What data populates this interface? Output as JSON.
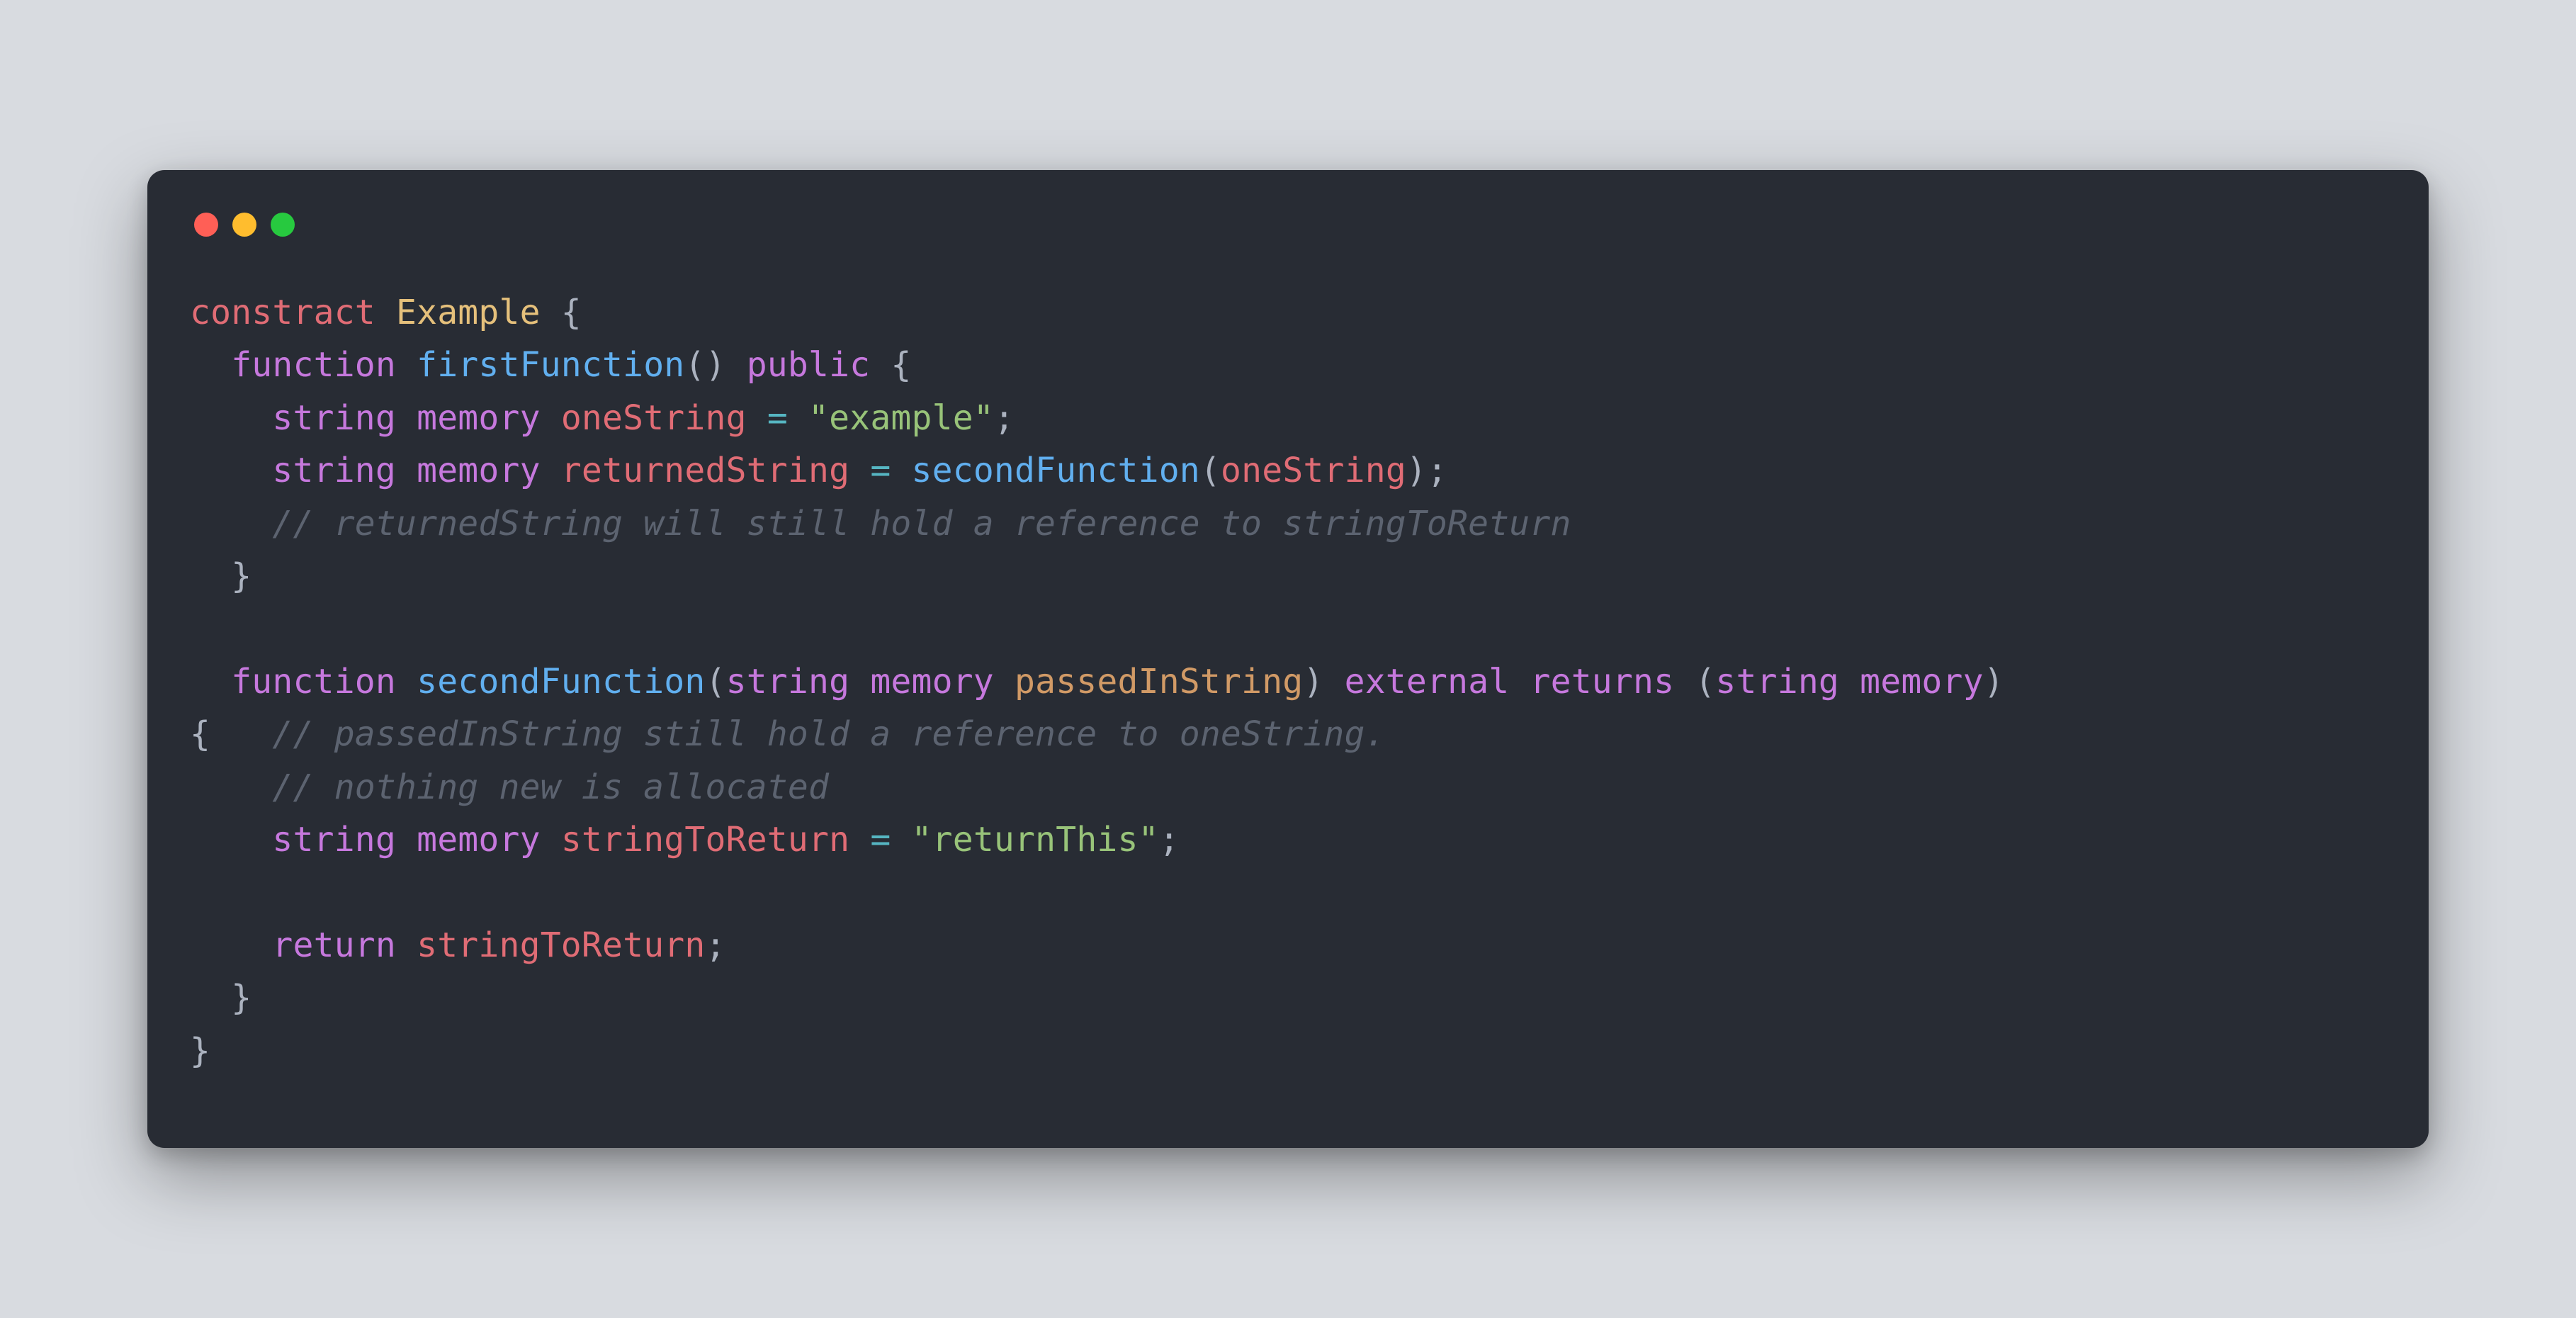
{
  "colors": {
    "background_page": "#d8dbe0",
    "background_window": "#282c34",
    "traffic_red": "#ff5f56",
    "traffic_yellow": "#ffbd2e",
    "traffic_green": "#27c93f",
    "keyword_red": "#e06c75",
    "keyword_purple": "#c678dd",
    "function_blue": "#61afef",
    "string_green": "#98c379",
    "operator_cyan": "#56b6c2",
    "identifier_yellow": "#e5c07b",
    "param_orange": "#d19a66",
    "comment_gray": "#5c6370",
    "plain": "#abb2bf"
  },
  "code": {
    "lines": [
      {
        "segments": [
          {
            "t": "constract",
            "c": "kw-red"
          },
          {
            "t": " ",
            "c": "plain"
          },
          {
            "t": "Example",
            "c": "ident"
          },
          {
            "t": " {",
            "c": "plain"
          }
        ]
      },
      {
        "segments": [
          {
            "t": "  ",
            "c": "plain"
          },
          {
            "t": "function",
            "c": "kw-purple"
          },
          {
            "t": " ",
            "c": "plain"
          },
          {
            "t": "firstFunction",
            "c": "fn"
          },
          {
            "t": "() ",
            "c": "plain"
          },
          {
            "t": "public",
            "c": "kw-purple"
          },
          {
            "t": " {",
            "c": "plain"
          }
        ]
      },
      {
        "segments": [
          {
            "t": "    ",
            "c": "plain"
          },
          {
            "t": "string",
            "c": "kw-purple"
          },
          {
            "t": " ",
            "c": "plain"
          },
          {
            "t": "memory",
            "c": "kw-purple"
          },
          {
            "t": " ",
            "c": "plain"
          },
          {
            "t": "oneString",
            "c": "kw-red"
          },
          {
            "t": " ",
            "c": "plain"
          },
          {
            "t": "=",
            "c": "op"
          },
          {
            "t": " ",
            "c": "plain"
          },
          {
            "t": "\"example\"",
            "c": "str"
          },
          {
            "t": ";",
            "c": "plain"
          }
        ]
      },
      {
        "segments": [
          {
            "t": "    ",
            "c": "plain"
          },
          {
            "t": "string",
            "c": "kw-purple"
          },
          {
            "t": " ",
            "c": "plain"
          },
          {
            "t": "memory",
            "c": "kw-purple"
          },
          {
            "t": " ",
            "c": "plain"
          },
          {
            "t": "returnedString",
            "c": "kw-red"
          },
          {
            "t": " ",
            "c": "plain"
          },
          {
            "t": "=",
            "c": "op"
          },
          {
            "t": " ",
            "c": "plain"
          },
          {
            "t": "secondFunction",
            "c": "fn"
          },
          {
            "t": "(",
            "c": "plain"
          },
          {
            "t": "oneString",
            "c": "kw-red"
          },
          {
            "t": ");",
            "c": "plain"
          }
        ]
      },
      {
        "segments": [
          {
            "t": "    ",
            "c": "plain"
          },
          {
            "t": "// returnedString will still hold a reference to stringToReturn",
            "c": "comment"
          }
        ]
      },
      {
        "segments": [
          {
            "t": "  }",
            "c": "plain"
          }
        ]
      },
      {
        "segments": [
          {
            "t": "",
            "c": "plain"
          }
        ]
      },
      {
        "segments": [
          {
            "t": "  ",
            "c": "plain"
          },
          {
            "t": "function",
            "c": "kw-purple"
          },
          {
            "t": " ",
            "c": "plain"
          },
          {
            "t": "secondFunction",
            "c": "fn"
          },
          {
            "t": "(",
            "c": "plain"
          },
          {
            "t": "string",
            "c": "kw-purple"
          },
          {
            "t": " ",
            "c": "plain"
          },
          {
            "t": "memory",
            "c": "kw-purple"
          },
          {
            "t": " ",
            "c": "plain"
          },
          {
            "t": "passedInString",
            "c": "param"
          },
          {
            "t": ") ",
            "c": "plain"
          },
          {
            "t": "external",
            "c": "kw-purple"
          },
          {
            "t": " ",
            "c": "plain"
          },
          {
            "t": "returns",
            "c": "kw-purple"
          },
          {
            "t": " (",
            "c": "plain"
          },
          {
            "t": "string",
            "c": "kw-purple"
          },
          {
            "t": " ",
            "c": "plain"
          },
          {
            "t": "memory",
            "c": "kw-purple"
          },
          {
            "t": ") ",
            "c": "plain"
          }
        ]
      },
      {
        "segments": [
          {
            "t": "{   ",
            "c": "plain"
          },
          {
            "t": "// passedInString still hold a reference to oneString.",
            "c": "comment"
          }
        ]
      },
      {
        "segments": [
          {
            "t": "    ",
            "c": "plain"
          },
          {
            "t": "// nothing new is allocated",
            "c": "comment"
          }
        ]
      },
      {
        "segments": [
          {
            "t": "    ",
            "c": "plain"
          },
          {
            "t": "string",
            "c": "kw-purple"
          },
          {
            "t": " ",
            "c": "plain"
          },
          {
            "t": "memory",
            "c": "kw-purple"
          },
          {
            "t": " ",
            "c": "plain"
          },
          {
            "t": "stringToReturn",
            "c": "kw-red"
          },
          {
            "t": " ",
            "c": "plain"
          },
          {
            "t": "=",
            "c": "op"
          },
          {
            "t": " ",
            "c": "plain"
          },
          {
            "t": "\"returnThis\"",
            "c": "str"
          },
          {
            "t": ";",
            "c": "plain"
          }
        ]
      },
      {
        "segments": [
          {
            "t": "",
            "c": "plain"
          }
        ]
      },
      {
        "segments": [
          {
            "t": "    ",
            "c": "plain"
          },
          {
            "t": "return",
            "c": "kw-purple"
          },
          {
            "t": " ",
            "c": "plain"
          },
          {
            "t": "stringToReturn",
            "c": "kw-red"
          },
          {
            "t": ";",
            "c": "plain"
          }
        ]
      },
      {
        "segments": [
          {
            "t": "  }",
            "c": "plain"
          }
        ]
      },
      {
        "segments": [
          {
            "t": "}",
            "c": "plain"
          }
        ]
      }
    ]
  }
}
